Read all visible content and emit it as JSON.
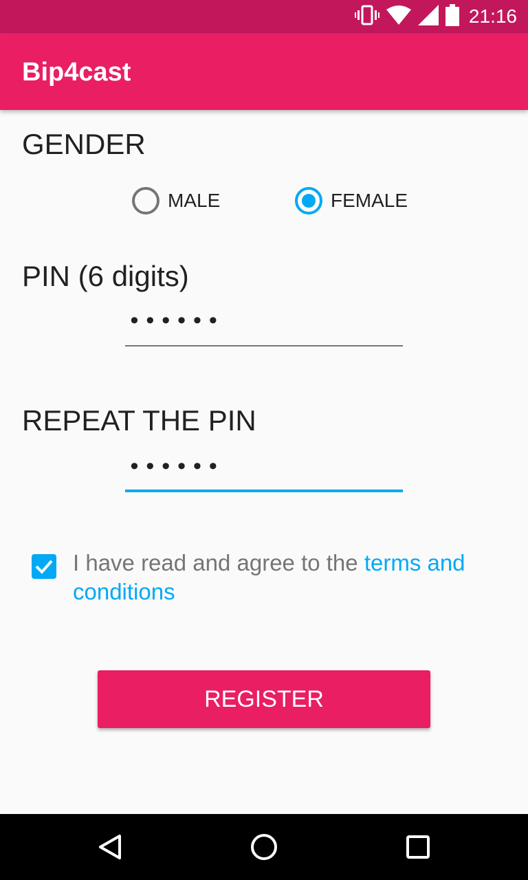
{
  "status_bar": {
    "time": "21:16",
    "icons": [
      "vibrate-icon",
      "wifi-icon",
      "signal-icon",
      "battery-icon"
    ]
  },
  "app_bar": {
    "title": "Bip4cast"
  },
  "gender": {
    "label": "GENDER",
    "options": [
      {
        "label": "MALE",
        "selected": false
      },
      {
        "label": "FEMALE",
        "selected": true
      }
    ]
  },
  "pin": {
    "label": "PIN (6 digits)",
    "value": "••••••"
  },
  "repeat_pin": {
    "label": "REPEAT THE PIN",
    "value": "••••••"
  },
  "terms": {
    "checked": true,
    "prefix": "I have read and agree to the ",
    "link": "terms and conditions"
  },
  "register_button": {
    "label": "REGISTER"
  },
  "nav_bar": {
    "icons": [
      "back-icon",
      "home-icon",
      "recents-icon"
    ]
  },
  "colors": {
    "primary": "#E91E63",
    "primary_dark": "#C2185B",
    "accent": "#03A9F4"
  }
}
